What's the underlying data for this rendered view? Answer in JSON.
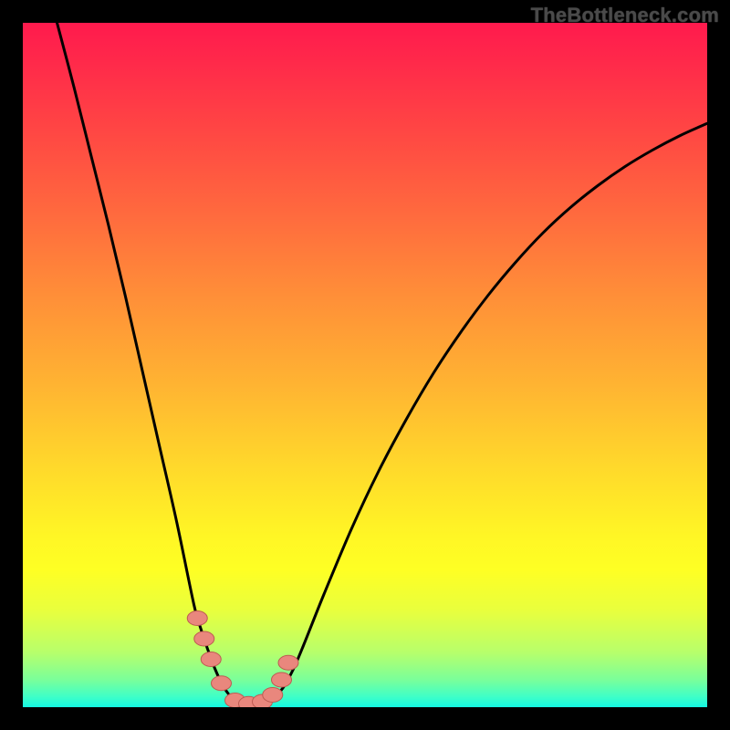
{
  "watermark": "TheBottleneck.com",
  "chart_data": {
    "type": "line",
    "title": "",
    "xlabel": "",
    "ylabel": "",
    "xlim": [
      0,
      1
    ],
    "ylim": [
      0,
      1
    ],
    "series": [
      {
        "name": "bottleneck-curve",
        "x": [
          0.05,
          0.075,
          0.1,
          0.125,
          0.15,
          0.175,
          0.2,
          0.225,
          0.25,
          0.26,
          0.27,
          0.28,
          0.29,
          0.3,
          0.31,
          0.32,
          0.33,
          0.34,
          0.35,
          0.365,
          0.38,
          0.395,
          0.41,
          0.44,
          0.48,
          0.52,
          0.56,
          0.6,
          0.64,
          0.68,
          0.72,
          0.76,
          0.8,
          0.84,
          0.88,
          0.92,
          0.96,
          1.0
        ],
        "y": [
          1.0,
          0.905,
          0.805,
          0.705,
          0.6,
          0.49,
          0.38,
          0.27,
          0.15,
          0.115,
          0.085,
          0.058,
          0.036,
          0.02,
          0.01,
          0.004,
          0.002,
          0.002,
          0.004,
          0.012,
          0.028,
          0.055,
          0.09,
          0.165,
          0.26,
          0.345,
          0.42,
          0.488,
          0.548,
          0.602,
          0.65,
          0.693,
          0.73,
          0.762,
          0.79,
          0.814,
          0.835,
          0.853
        ]
      },
      {
        "name": "marker-dots",
        "x": [
          0.255,
          0.265,
          0.275,
          0.29,
          0.31,
          0.33,
          0.35,
          0.365,
          0.378,
          0.388
        ],
        "y": [
          0.13,
          0.1,
          0.07,
          0.035,
          0.01,
          0.005,
          0.008,
          0.018,
          0.04,
          0.065
        ]
      }
    ],
    "colors": {
      "curve": "#000000",
      "marker_fill": "#e9877d",
      "marker_stroke": "#bd5a51"
    },
    "gradient_stops": [
      {
        "pos": 0.0,
        "color": "#ff1a4d"
      },
      {
        "pos": 0.5,
        "color": "#ffd92b"
      },
      {
        "pos": 1.0,
        "color": "#14f8e2"
      }
    ]
  }
}
